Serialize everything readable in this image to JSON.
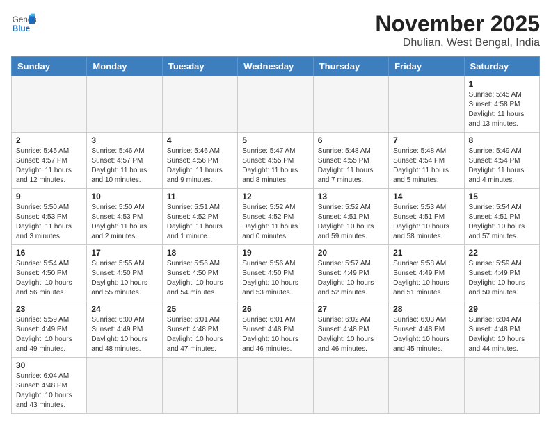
{
  "logo": {
    "general": "General",
    "blue": "Blue"
  },
  "title": "November 2025",
  "subtitle": "Dhulian, West Bengal, India",
  "weekdays": [
    "Sunday",
    "Monday",
    "Tuesday",
    "Wednesday",
    "Thursday",
    "Friday",
    "Saturday"
  ],
  "days": [
    {
      "num": "",
      "info": ""
    },
    {
      "num": "",
      "info": ""
    },
    {
      "num": "",
      "info": ""
    },
    {
      "num": "",
      "info": ""
    },
    {
      "num": "",
      "info": ""
    },
    {
      "num": "",
      "info": ""
    },
    {
      "num": "1",
      "info": "Sunrise: 5:45 AM\nSunset: 4:58 PM\nDaylight: 11 hours and 13 minutes."
    },
    {
      "num": "2",
      "info": "Sunrise: 5:45 AM\nSunset: 4:57 PM\nDaylight: 11 hours and 12 minutes."
    },
    {
      "num": "3",
      "info": "Sunrise: 5:46 AM\nSunset: 4:57 PM\nDaylight: 11 hours and 10 minutes."
    },
    {
      "num": "4",
      "info": "Sunrise: 5:46 AM\nSunset: 4:56 PM\nDaylight: 11 hours and 9 minutes."
    },
    {
      "num": "5",
      "info": "Sunrise: 5:47 AM\nSunset: 4:55 PM\nDaylight: 11 hours and 8 minutes."
    },
    {
      "num": "6",
      "info": "Sunrise: 5:48 AM\nSunset: 4:55 PM\nDaylight: 11 hours and 7 minutes."
    },
    {
      "num": "7",
      "info": "Sunrise: 5:48 AM\nSunset: 4:54 PM\nDaylight: 11 hours and 5 minutes."
    },
    {
      "num": "8",
      "info": "Sunrise: 5:49 AM\nSunset: 4:54 PM\nDaylight: 11 hours and 4 minutes."
    },
    {
      "num": "9",
      "info": "Sunrise: 5:50 AM\nSunset: 4:53 PM\nDaylight: 11 hours and 3 minutes."
    },
    {
      "num": "10",
      "info": "Sunrise: 5:50 AM\nSunset: 4:53 PM\nDaylight: 11 hours and 2 minutes."
    },
    {
      "num": "11",
      "info": "Sunrise: 5:51 AM\nSunset: 4:52 PM\nDaylight: 11 hours and 1 minute."
    },
    {
      "num": "12",
      "info": "Sunrise: 5:52 AM\nSunset: 4:52 PM\nDaylight: 11 hours and 0 minutes."
    },
    {
      "num": "13",
      "info": "Sunrise: 5:52 AM\nSunset: 4:51 PM\nDaylight: 10 hours and 59 minutes."
    },
    {
      "num": "14",
      "info": "Sunrise: 5:53 AM\nSunset: 4:51 PM\nDaylight: 10 hours and 58 minutes."
    },
    {
      "num": "15",
      "info": "Sunrise: 5:54 AM\nSunset: 4:51 PM\nDaylight: 10 hours and 57 minutes."
    },
    {
      "num": "16",
      "info": "Sunrise: 5:54 AM\nSunset: 4:50 PM\nDaylight: 10 hours and 56 minutes."
    },
    {
      "num": "17",
      "info": "Sunrise: 5:55 AM\nSunset: 4:50 PM\nDaylight: 10 hours and 55 minutes."
    },
    {
      "num": "18",
      "info": "Sunrise: 5:56 AM\nSunset: 4:50 PM\nDaylight: 10 hours and 54 minutes."
    },
    {
      "num": "19",
      "info": "Sunrise: 5:56 AM\nSunset: 4:50 PM\nDaylight: 10 hours and 53 minutes."
    },
    {
      "num": "20",
      "info": "Sunrise: 5:57 AM\nSunset: 4:49 PM\nDaylight: 10 hours and 52 minutes."
    },
    {
      "num": "21",
      "info": "Sunrise: 5:58 AM\nSunset: 4:49 PM\nDaylight: 10 hours and 51 minutes."
    },
    {
      "num": "22",
      "info": "Sunrise: 5:59 AM\nSunset: 4:49 PM\nDaylight: 10 hours and 50 minutes."
    },
    {
      "num": "23",
      "info": "Sunrise: 5:59 AM\nSunset: 4:49 PM\nDaylight: 10 hours and 49 minutes."
    },
    {
      "num": "24",
      "info": "Sunrise: 6:00 AM\nSunset: 4:49 PM\nDaylight: 10 hours and 48 minutes."
    },
    {
      "num": "25",
      "info": "Sunrise: 6:01 AM\nSunset: 4:48 PM\nDaylight: 10 hours and 47 minutes."
    },
    {
      "num": "26",
      "info": "Sunrise: 6:01 AM\nSunset: 4:48 PM\nDaylight: 10 hours and 46 minutes."
    },
    {
      "num": "27",
      "info": "Sunrise: 6:02 AM\nSunset: 4:48 PM\nDaylight: 10 hours and 46 minutes."
    },
    {
      "num": "28",
      "info": "Sunrise: 6:03 AM\nSunset: 4:48 PM\nDaylight: 10 hours and 45 minutes."
    },
    {
      "num": "29",
      "info": "Sunrise: 6:04 AM\nSunset: 4:48 PM\nDaylight: 10 hours and 44 minutes."
    },
    {
      "num": "30",
      "info": "Sunrise: 6:04 AM\nSunset: 4:48 PM\nDaylight: 10 hours and 43 minutes."
    }
  ]
}
